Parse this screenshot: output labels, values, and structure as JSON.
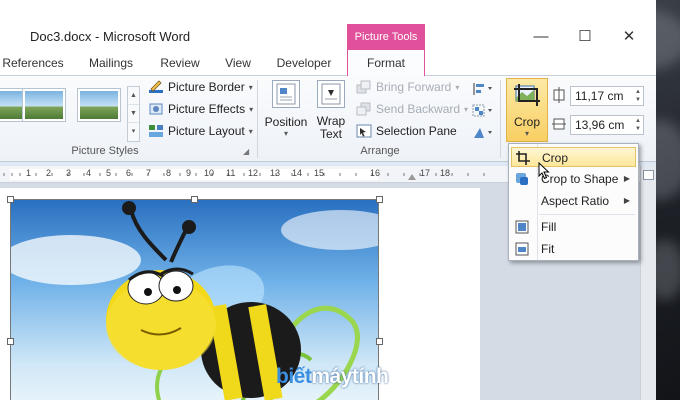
{
  "window": {
    "title": "Doc3.docx - Microsoft Word",
    "context_tab_group": "Picture Tools",
    "controls": {
      "minimize": "—",
      "maximize": "☐",
      "close": "✕"
    }
  },
  "tabs": [
    {
      "label": "References"
    },
    {
      "label": "Mailings"
    },
    {
      "label": "Review"
    },
    {
      "label": "View"
    },
    {
      "label": "Developer"
    },
    {
      "label": "Format"
    }
  ],
  "ribbon": {
    "picture_styles": {
      "label": "Picture Styles",
      "commands": [
        {
          "label": "Picture Border",
          "icon": "pen-border-icon"
        },
        {
          "label": "Picture Effects",
          "icon": "effects-icon"
        },
        {
          "label": "Picture Layout",
          "icon": "layout-icon"
        }
      ]
    },
    "arrange": {
      "label": "Arrange",
      "position": "Position",
      "wrap_text_line1": "Wrap",
      "wrap_text_line2": "Text",
      "commands": [
        {
          "label": "Bring Forward",
          "enabled": false
        },
        {
          "label": "Send Backward",
          "enabled": false
        },
        {
          "label": "Selection Pane",
          "enabled": true
        }
      ]
    },
    "size": {
      "crop": "Crop",
      "height": "11,17 cm",
      "width": "13,96 cm"
    }
  },
  "ruler": {
    "labels": [
      "1",
      "2",
      "3",
      "4",
      "5",
      "6",
      "7",
      "8",
      "9",
      "10",
      "11",
      "12",
      "13",
      "14",
      "15",
      "16",
      "17",
      "18"
    ]
  },
  "crop_menu": {
    "items": [
      {
        "label": "Crop",
        "icon": "crop-icon",
        "submenu": false,
        "highlighted": true
      },
      {
        "label": "Crop to Shape",
        "icon": "crop-shape-icon",
        "submenu": true,
        "highlighted": false
      },
      {
        "label": "Aspect Ratio",
        "icon": "",
        "submenu": true,
        "highlighted": false
      },
      {
        "label": "Fill",
        "icon": "fill-icon",
        "submenu": false,
        "highlighted": false
      },
      {
        "label": "Fit",
        "icon": "fit-icon",
        "submenu": false,
        "highlighted": false
      }
    ]
  },
  "watermark": {
    "part1": "biết",
    "part2": "máytính"
  },
  "colors": {
    "context_accent": "#e1509a",
    "crop_active": "#f8cf62",
    "menu_highlight": "#fde79a"
  }
}
